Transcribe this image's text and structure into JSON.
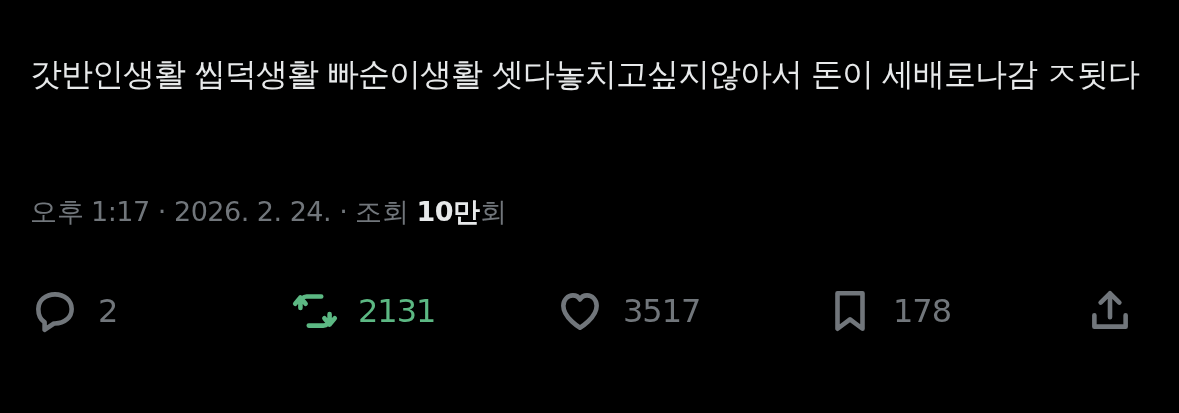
{
  "post": {
    "text": "갓반인생활 씹덕생활 빠순이생활 셋다놓치고싶지않아서 돈이 세배로나감 ㅈ됫다",
    "meta": "오후 1:17 · 2026. 2. 24. · 조회 **10만**회"
  },
  "actions": [
    {
      "kind": "reply",
      "count": "2",
      "active": false
    },
    {
      "kind": "repost",
      "count": "2131",
      "active": true
    },
    {
      "kind": "like",
      "count": "3517",
      "active": false
    },
    {
      "kind": "bookmark",
      "count": "178",
      "active": false
    },
    {
      "kind": "share",
      "active": false
    }
  ]
}
